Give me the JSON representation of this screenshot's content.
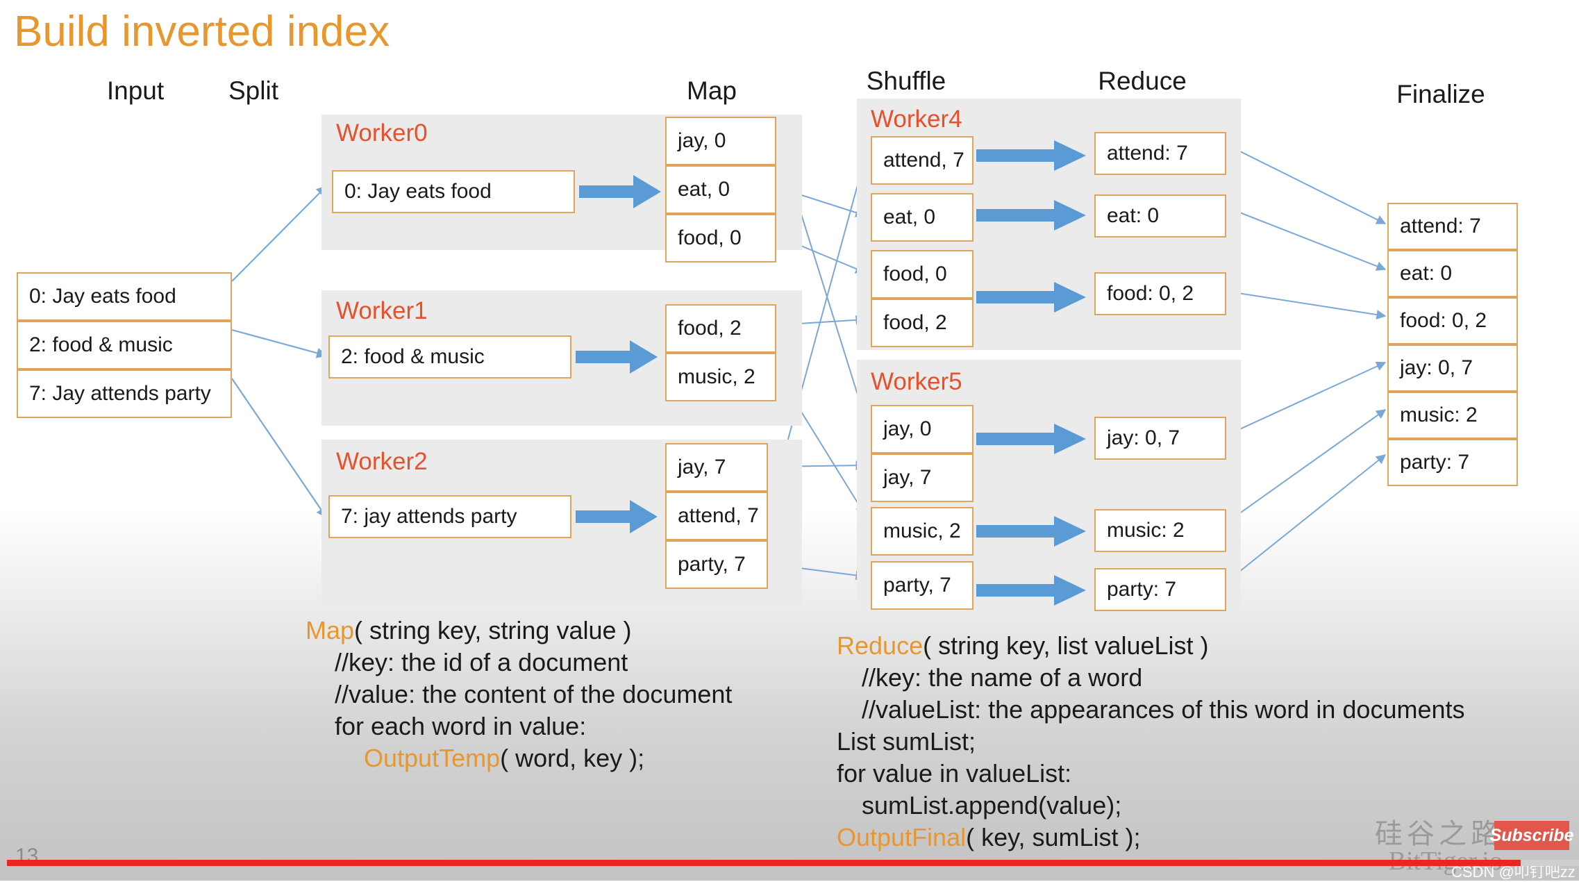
{
  "slide": {
    "title": "Build inverted index",
    "number": "13",
    "watermark_cn": "硅谷之路",
    "watermark_en": "BitTiger.io",
    "subscribe_label": "Subscribe",
    "csdn_credit": "CSDN @叩钉吧zz",
    "accent_orange": "#E8972E",
    "worker_red": "#E8502A",
    "box_border": "#E0A55B",
    "panel_gray": "#EBEBEB",
    "arrow_blue": "#5B9BD5",
    "progress_red": "#E8281E"
  },
  "columns": {
    "input": "Input",
    "split": "Split",
    "map": "Map",
    "shuffle": "Shuffle",
    "reduce": "Reduce",
    "finalize": "Finalize"
  },
  "input_docs": [
    {
      "text": "0: Jay eats food"
    },
    {
      "text": "2: food & music"
    },
    {
      "text": "7: Jay attends party"
    }
  ],
  "map_workers": [
    {
      "name": "Worker0",
      "input": "0: Jay eats food",
      "outputs": [
        "jay, 0",
        "eat, 0",
        "food, 0"
      ]
    },
    {
      "name": "Worker1",
      "input": "2: food & music",
      "outputs": [
        "food, 2",
        "music, 2"
      ]
    },
    {
      "name": "Worker2",
      "input": "7: jay attends party",
      "outputs": [
        "jay, 7",
        "attend, 7",
        "party, 7"
      ]
    }
  ],
  "reduce_workers": [
    {
      "name": "Worker4",
      "shuffle": [
        "attend, 7",
        "eat, 0",
        "food, 0",
        "food, 2"
      ],
      "reduced": [
        "attend: 7",
        "eat: 0",
        "food: 0, 2"
      ]
    },
    {
      "name": "Worker5",
      "shuffle": [
        "jay, 0",
        "jay, 7",
        "music, 2",
        "party, 7"
      ],
      "reduced": [
        "jay: 0, 7",
        "music: 2",
        "party: 7"
      ]
    }
  ],
  "finalize_items": [
    "attend: 7",
    "eat: 0",
    "food: 0, 2",
    "jay: 0, 7",
    "music: 2",
    "party: 7"
  ],
  "map_code": {
    "l0_kw": "Map",
    "l0_rest": "( string key, string value )",
    "l1": "//key: the id of a document",
    "l2": "//value: the content of the document",
    "l3": "for each word in value:",
    "l4_kw": "OutputTemp",
    "l4_rest": "( word, key );"
  },
  "reduce_code": {
    "l0_kw": "Reduce",
    "l0_rest": "( string key, list valueList )",
    "l1": "//key: the name of a word",
    "l2": "//valueList: the appearances of this word in documents",
    "l3": "List sumList;",
    "l4": "for value in valueList:",
    "l5": "sumList.append(value);",
    "l6_kw": "OutputFinal",
    "l6_rest": "( key, sumList );"
  }
}
